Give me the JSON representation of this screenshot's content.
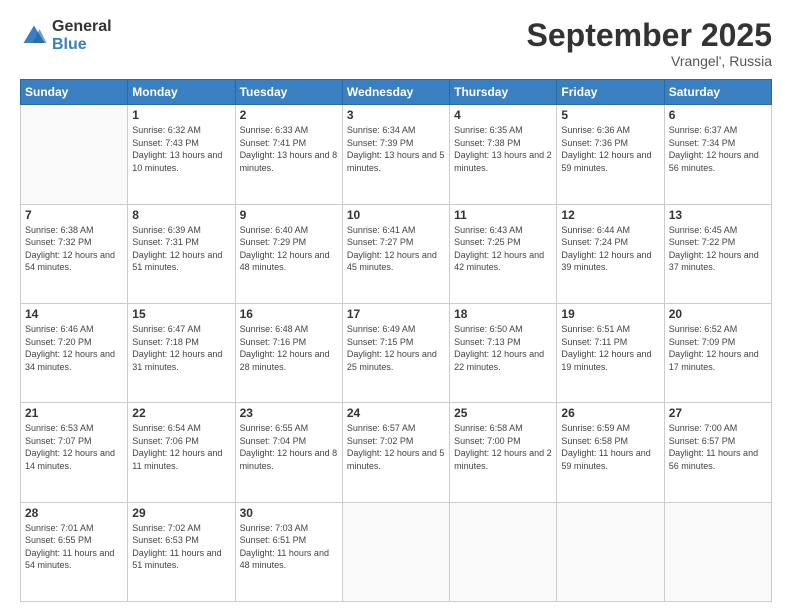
{
  "logo": {
    "general": "General",
    "blue": "Blue"
  },
  "header": {
    "month": "September 2025",
    "location": "Vrangel', Russia"
  },
  "weekdays": [
    "Sunday",
    "Monday",
    "Tuesday",
    "Wednesday",
    "Thursday",
    "Friday",
    "Saturday"
  ],
  "days": [
    {
      "date": "",
      "sunrise": "",
      "sunset": "",
      "daylight": ""
    },
    {
      "date": "1",
      "sunrise": "Sunrise: 6:32 AM",
      "sunset": "Sunset: 7:43 PM",
      "daylight": "Daylight: 13 hours and 10 minutes."
    },
    {
      "date": "2",
      "sunrise": "Sunrise: 6:33 AM",
      "sunset": "Sunset: 7:41 PM",
      "daylight": "Daylight: 13 hours and 8 minutes."
    },
    {
      "date": "3",
      "sunrise": "Sunrise: 6:34 AM",
      "sunset": "Sunset: 7:39 PM",
      "daylight": "Daylight: 13 hours and 5 minutes."
    },
    {
      "date": "4",
      "sunrise": "Sunrise: 6:35 AM",
      "sunset": "Sunset: 7:38 PM",
      "daylight": "Daylight: 13 hours and 2 minutes."
    },
    {
      "date": "5",
      "sunrise": "Sunrise: 6:36 AM",
      "sunset": "Sunset: 7:36 PM",
      "daylight": "Daylight: 12 hours and 59 minutes."
    },
    {
      "date": "6",
      "sunrise": "Sunrise: 6:37 AM",
      "sunset": "Sunset: 7:34 PM",
      "daylight": "Daylight: 12 hours and 56 minutes."
    },
    {
      "date": "7",
      "sunrise": "Sunrise: 6:38 AM",
      "sunset": "Sunset: 7:32 PM",
      "daylight": "Daylight: 12 hours and 54 minutes."
    },
    {
      "date": "8",
      "sunrise": "Sunrise: 6:39 AM",
      "sunset": "Sunset: 7:31 PM",
      "daylight": "Daylight: 12 hours and 51 minutes."
    },
    {
      "date": "9",
      "sunrise": "Sunrise: 6:40 AM",
      "sunset": "Sunset: 7:29 PM",
      "daylight": "Daylight: 12 hours and 48 minutes."
    },
    {
      "date": "10",
      "sunrise": "Sunrise: 6:41 AM",
      "sunset": "Sunset: 7:27 PM",
      "daylight": "Daylight: 12 hours and 45 minutes."
    },
    {
      "date": "11",
      "sunrise": "Sunrise: 6:43 AM",
      "sunset": "Sunset: 7:25 PM",
      "daylight": "Daylight: 12 hours and 42 minutes."
    },
    {
      "date": "12",
      "sunrise": "Sunrise: 6:44 AM",
      "sunset": "Sunset: 7:24 PM",
      "daylight": "Daylight: 12 hours and 39 minutes."
    },
    {
      "date": "13",
      "sunrise": "Sunrise: 6:45 AM",
      "sunset": "Sunset: 7:22 PM",
      "daylight": "Daylight: 12 hours and 37 minutes."
    },
    {
      "date": "14",
      "sunrise": "Sunrise: 6:46 AM",
      "sunset": "Sunset: 7:20 PM",
      "daylight": "Daylight: 12 hours and 34 minutes."
    },
    {
      "date": "15",
      "sunrise": "Sunrise: 6:47 AM",
      "sunset": "Sunset: 7:18 PM",
      "daylight": "Daylight: 12 hours and 31 minutes."
    },
    {
      "date": "16",
      "sunrise": "Sunrise: 6:48 AM",
      "sunset": "Sunset: 7:16 PM",
      "daylight": "Daylight: 12 hours and 28 minutes."
    },
    {
      "date": "17",
      "sunrise": "Sunrise: 6:49 AM",
      "sunset": "Sunset: 7:15 PM",
      "daylight": "Daylight: 12 hours and 25 minutes."
    },
    {
      "date": "18",
      "sunrise": "Sunrise: 6:50 AM",
      "sunset": "Sunset: 7:13 PM",
      "daylight": "Daylight: 12 hours and 22 minutes."
    },
    {
      "date": "19",
      "sunrise": "Sunrise: 6:51 AM",
      "sunset": "Sunset: 7:11 PM",
      "daylight": "Daylight: 12 hours and 19 minutes."
    },
    {
      "date": "20",
      "sunrise": "Sunrise: 6:52 AM",
      "sunset": "Sunset: 7:09 PM",
      "daylight": "Daylight: 12 hours and 17 minutes."
    },
    {
      "date": "21",
      "sunrise": "Sunrise: 6:53 AM",
      "sunset": "Sunset: 7:07 PM",
      "daylight": "Daylight: 12 hours and 14 minutes."
    },
    {
      "date": "22",
      "sunrise": "Sunrise: 6:54 AM",
      "sunset": "Sunset: 7:06 PM",
      "daylight": "Daylight: 12 hours and 11 minutes."
    },
    {
      "date": "23",
      "sunrise": "Sunrise: 6:55 AM",
      "sunset": "Sunset: 7:04 PM",
      "daylight": "Daylight: 12 hours and 8 minutes."
    },
    {
      "date": "24",
      "sunrise": "Sunrise: 6:57 AM",
      "sunset": "Sunset: 7:02 PM",
      "daylight": "Daylight: 12 hours and 5 minutes."
    },
    {
      "date": "25",
      "sunrise": "Sunrise: 6:58 AM",
      "sunset": "Sunset: 7:00 PM",
      "daylight": "Daylight: 12 hours and 2 minutes."
    },
    {
      "date": "26",
      "sunrise": "Sunrise: 6:59 AM",
      "sunset": "Sunset: 6:58 PM",
      "daylight": "Daylight: 11 hours and 59 minutes."
    },
    {
      "date": "27",
      "sunrise": "Sunrise: 7:00 AM",
      "sunset": "Sunset: 6:57 PM",
      "daylight": "Daylight: 11 hours and 56 minutes."
    },
    {
      "date": "28",
      "sunrise": "Sunrise: 7:01 AM",
      "sunset": "Sunset: 6:55 PM",
      "daylight": "Daylight: 11 hours and 54 minutes."
    },
    {
      "date": "29",
      "sunrise": "Sunrise: 7:02 AM",
      "sunset": "Sunset: 6:53 PM",
      "daylight": "Daylight: 11 hours and 51 minutes."
    },
    {
      "date": "30",
      "sunrise": "Sunrise: 7:03 AM",
      "sunset": "Sunset: 6:51 PM",
      "daylight": "Daylight: 11 hours and 48 minutes."
    },
    {
      "date": "",
      "sunrise": "",
      "sunset": "",
      "daylight": ""
    },
    {
      "date": "",
      "sunrise": "",
      "sunset": "",
      "daylight": ""
    },
    {
      "date": "",
      "sunrise": "",
      "sunset": "",
      "daylight": ""
    },
    {
      "date": "",
      "sunrise": "",
      "sunset": "",
      "daylight": ""
    }
  ]
}
